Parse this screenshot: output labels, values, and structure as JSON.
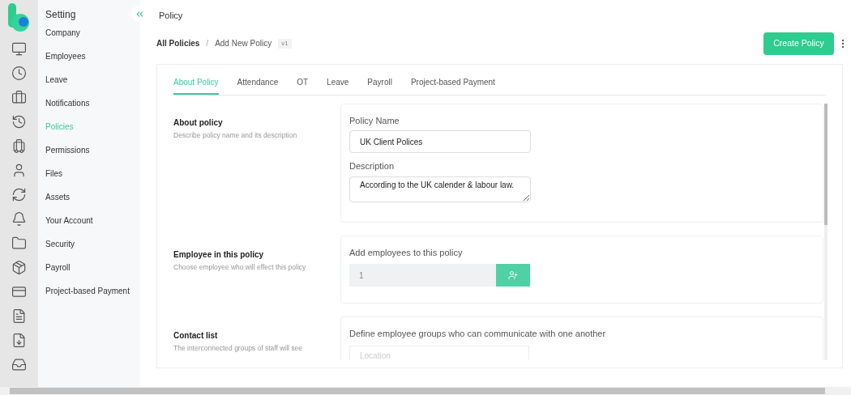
{
  "sidebar": {
    "title": "Setting",
    "items": [
      {
        "label": "Company",
        "selected": false
      },
      {
        "label": "Employees",
        "selected": false
      },
      {
        "label": "Leave",
        "selected": false
      },
      {
        "label": "Notifications",
        "selected": false
      },
      {
        "label": "Policies",
        "selected": true
      },
      {
        "label": "Permissions",
        "selected": false
      },
      {
        "label": "Files",
        "selected": false
      },
      {
        "label": "Assets",
        "selected": false
      },
      {
        "label": "Your Account",
        "selected": false
      },
      {
        "label": "Security",
        "selected": false
      },
      {
        "label": "Payroll",
        "selected": false
      },
      {
        "label": "Project-based Payment",
        "selected": false
      }
    ]
  },
  "page_title": "Policy",
  "breadcrumb": {
    "root": "All Policies",
    "separator": "/",
    "current": "Add New Policy",
    "version": "v1"
  },
  "create_button": "Create Policy",
  "tabs": [
    {
      "label": "About Policy",
      "selected": true
    },
    {
      "label": "Attendance",
      "selected": false
    },
    {
      "label": "OT",
      "selected": false
    },
    {
      "label": "Leave",
      "selected": false
    },
    {
      "label": "Payroll",
      "selected": false
    },
    {
      "label": "Project-based Payment",
      "selected": false
    }
  ],
  "sections": [
    {
      "kind": "fields",
      "title": "About policy",
      "description": "Describe policy name and its description",
      "fields": [
        {
          "kind": "input",
          "label": "Policy Name",
          "value": "UK Client Polices"
        },
        {
          "kind": "textarea",
          "label": "Description",
          "value": "According to the UK calender & labour law."
        }
      ]
    },
    {
      "kind": "picker",
      "title": "Employee in this policy",
      "description": "Choose employee who will effect this policy",
      "label": "Add employees to this policy",
      "value": "1"
    },
    {
      "kind": "select",
      "title": "Contact list",
      "description": "The interconnected groups of staff will see",
      "label": "Define employee groups who can communicate with one another",
      "placeholder": "Location"
    }
  ]
}
